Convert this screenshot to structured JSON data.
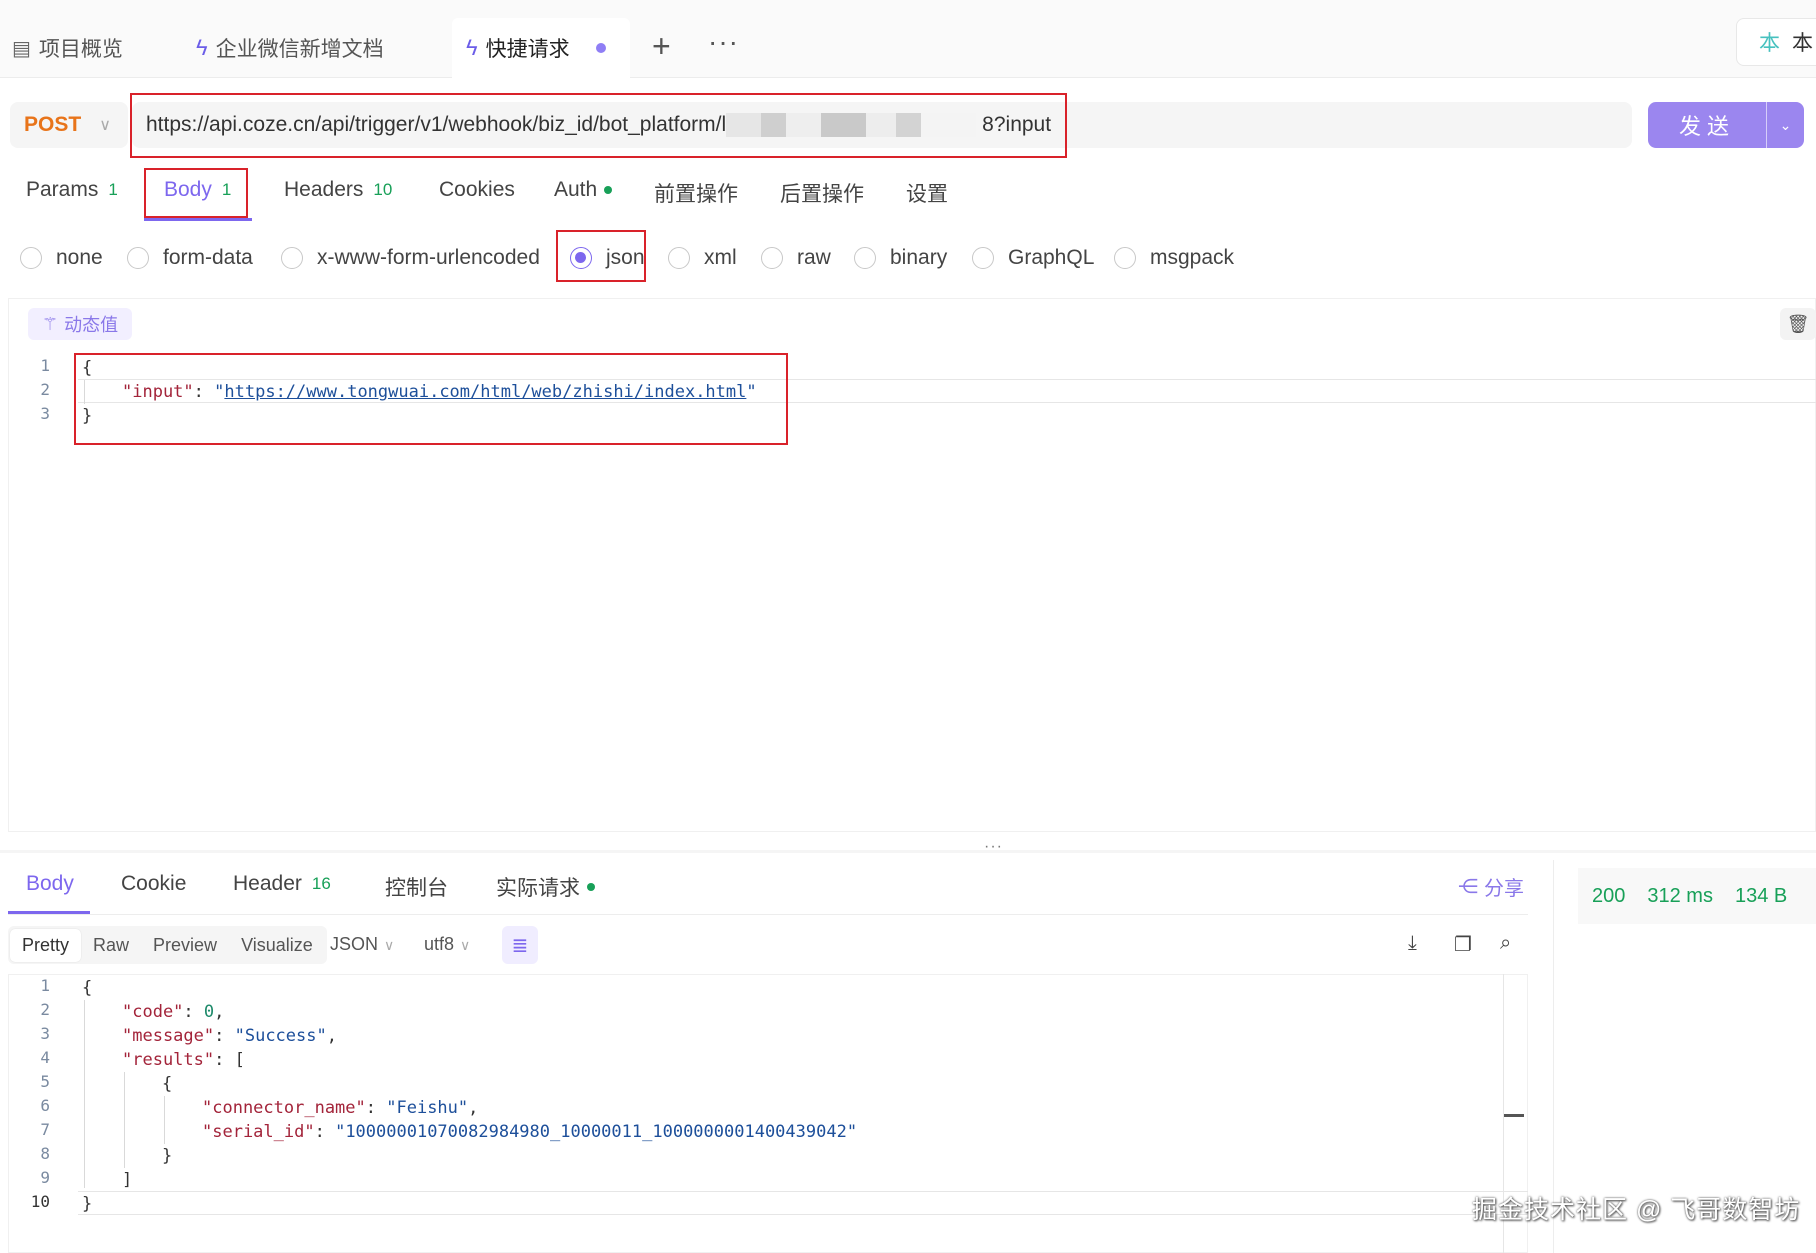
{
  "tabs": [
    {
      "icon": "project-icon",
      "label": "项目概览"
    },
    {
      "icon": "bolt-icon",
      "label": "企业微信新增文档"
    },
    {
      "icon": "bolt-icon",
      "label": "快捷请求"
    }
  ],
  "tab_actions": {
    "plus": "+",
    "more": "···"
  },
  "env": {
    "icon_text": "本",
    "label": "本"
  },
  "request": {
    "method": "POST",
    "url_prefix": "https://api.coze.cn/api/trigger/v1/webhook/biz_id/bot_platform/",
    "url_prefix_char": "l",
    "url_suffix": "8?input",
    "send_label": "发送"
  },
  "request_tabs": [
    {
      "label": "Params",
      "count": "1"
    },
    {
      "label": "Body",
      "count": "1"
    },
    {
      "label": "Headers",
      "count": "10"
    },
    {
      "label": "Cookies",
      "count": ""
    },
    {
      "label": "Auth",
      "count": ""
    },
    {
      "label": "前置操作",
      "count": ""
    },
    {
      "label": "后置操作",
      "count": ""
    },
    {
      "label": "设置",
      "count": ""
    }
  ],
  "body_types": [
    "none",
    "form-data",
    "x-www-form-urlencoded",
    "json",
    "xml",
    "raw",
    "binary",
    "GraphQL",
    "msgpack"
  ],
  "body_type_selected": "json",
  "dynamic_value_label": "动态值",
  "request_body": {
    "lines": [
      "1",
      "2",
      "3"
    ],
    "open": "{",
    "key": "\"input\"",
    "colon": ": ",
    "value_quote": "\"",
    "value": "https://www.tongwuai.com/html/web/zhishi/index.html",
    "close": "}"
  },
  "response_tabs": [
    {
      "label": "Body",
      "count": ""
    },
    {
      "label": "Cookie",
      "count": ""
    },
    {
      "label": "Header",
      "count": "16"
    },
    {
      "label": "控制台",
      "count": ""
    },
    {
      "label": "实际请求",
      "count": ""
    }
  ],
  "share_label": "分享",
  "status": {
    "code": "200",
    "time": "312 ms",
    "size": "134 B"
  },
  "view_modes": [
    "Pretty",
    "Raw",
    "Preview",
    "Visualize"
  ],
  "format": "JSON",
  "encoding": "utf8",
  "response_body": {
    "line_numbers": [
      "1",
      "2",
      "3",
      "4",
      "5",
      "6",
      "7",
      "8",
      "9",
      "10"
    ],
    "l1": "{",
    "code_key": "\"code\"",
    "code_val": "0",
    "message_key": "\"message\"",
    "message_val": "\"Success\"",
    "results_key": "\"results\"",
    "arr_open": "[",
    "obj_open": "{",
    "connector_key": "\"connector_name\"",
    "connector_val": "\"Feishu\"",
    "serial_key": "\"serial_id\"",
    "serial_val": "\"10000001070082984980_10000011_1000000001400439042\"",
    "obj_close": "}",
    "arr_close": "]",
    "l10": "}"
  },
  "watermark": "掘金技术社区 @ 飞哥数智坊"
}
